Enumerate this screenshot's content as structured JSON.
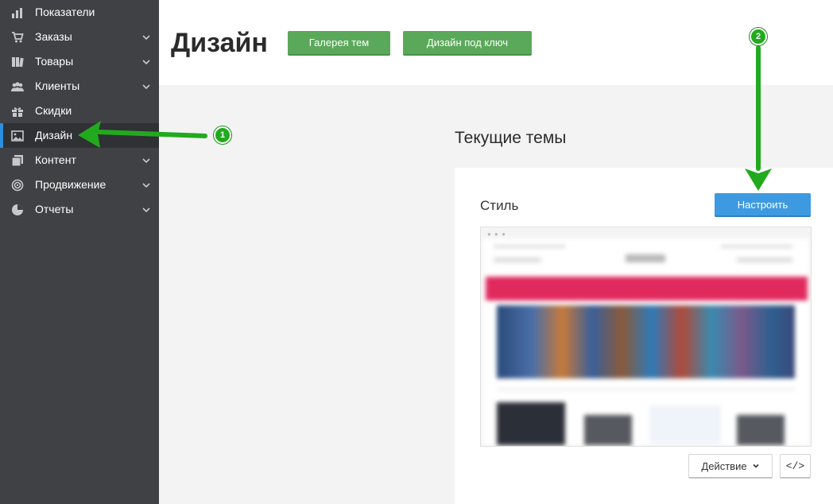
{
  "sidebar": {
    "items": [
      {
        "label": "Показатели",
        "icon": "bar-chart-icon",
        "has_chevron": false
      },
      {
        "label": "Заказы",
        "icon": "cart-icon",
        "has_chevron": true
      },
      {
        "label": "Товары",
        "icon": "books-icon",
        "has_chevron": true
      },
      {
        "label": "Клиенты",
        "icon": "users-icon",
        "has_chevron": true
      },
      {
        "label": "Скидки",
        "icon": "gift-icon",
        "has_chevron": false
      },
      {
        "label": "Дизайн",
        "icon": "image-icon",
        "has_chevron": false,
        "active": true
      },
      {
        "label": "Контент",
        "icon": "pages-icon",
        "has_chevron": true
      },
      {
        "label": "Продвижение",
        "icon": "target-icon",
        "has_chevron": true
      },
      {
        "label": "Отчеты",
        "icon": "pie-chart-icon",
        "has_chevron": true
      }
    ]
  },
  "header": {
    "title": "Дизайн",
    "gallery_button": "Галерея тем",
    "turnkey_button": "Дизайн под ключ"
  },
  "main": {
    "section_title": "Текущие темы",
    "card": {
      "label": "Стиль",
      "configure_button": "Настроить",
      "action_button": "Действие",
      "code_button": "</>"
    }
  },
  "annotations": {
    "step1": "1",
    "step2": "2"
  },
  "colors": {
    "sidebar_bg": "#3f4144",
    "accent_blue": "#3d9ae0",
    "button_green": "#5aa95a",
    "annotation_green": "#22aa1e",
    "banner_pink": "#e02a5e"
  }
}
